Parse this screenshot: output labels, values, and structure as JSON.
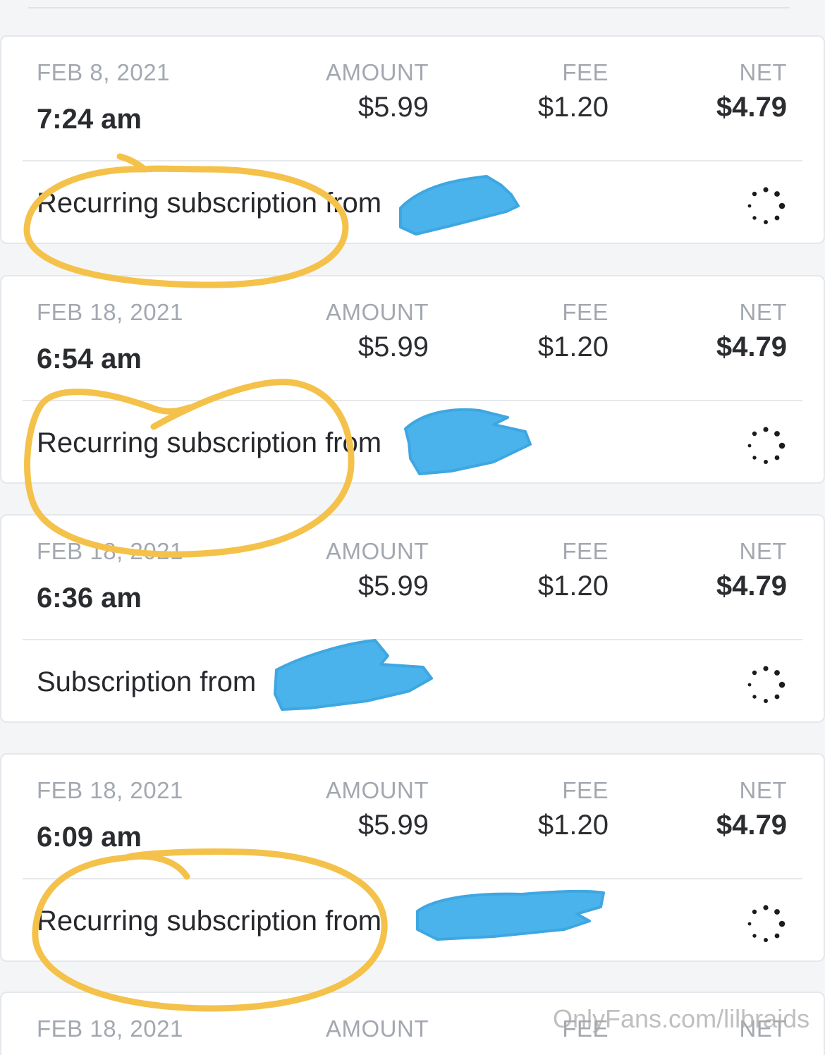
{
  "labels": {
    "amount": "AMOUNT",
    "fee": "FEE",
    "net": "NET"
  },
  "transactions": [
    {
      "date": "FEB  8, 2021",
      "time": "7:24 am",
      "amount": "$5.99",
      "fee": "$1.20",
      "net": "$4.79",
      "description": "Recurring subscription from"
    },
    {
      "date": "FEB 18, 2021",
      "time": "6:54 am",
      "amount": "$5.99",
      "fee": "$1.20",
      "net": "$4.79",
      "description": "Recurring subscription from"
    },
    {
      "date": "FEB 18, 2021",
      "time": "6:36 am",
      "amount": "$5.99",
      "fee": "$1.20",
      "net": "$4.79",
      "description": "Subscription from"
    },
    {
      "date": "FEB 18, 2021",
      "time": "6:09 am",
      "amount": "$5.99",
      "fee": "$1.20",
      "net": "$4.79",
      "description": "Recurring subscription from"
    },
    {
      "date": "FEB 18, 2021"
    }
  ],
  "watermark": "OnlyFans.com/lilbraids",
  "colors": {
    "annotation_circle": "#f4c24a",
    "redaction": "#4ab3ec",
    "label_gray": "#a3a8b0"
  },
  "icons": {
    "status": "loading-spinner-icon"
  }
}
